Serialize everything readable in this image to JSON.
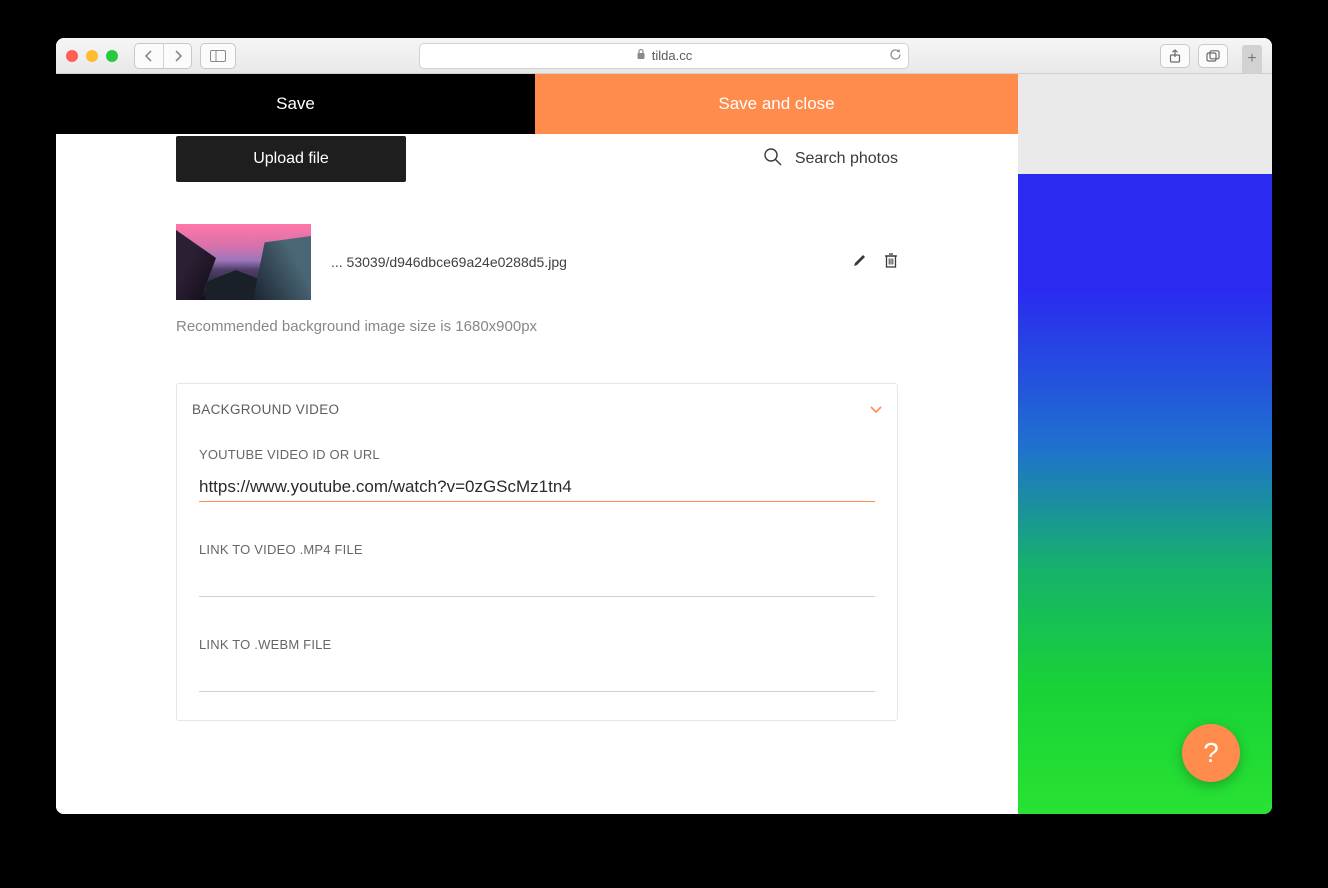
{
  "browser": {
    "url_host": "tilda.cc"
  },
  "actions": {
    "save": "Save",
    "save_and_close": "Save and close"
  },
  "upload": {
    "button": "Upload file",
    "search_photos": "Search photos"
  },
  "image": {
    "filename": "... 53039/d946dbce69a24e0288d5.jpg",
    "recommend": "Recommended background image size is 1680x900px"
  },
  "video": {
    "section_title": "BACKGROUND VIDEO",
    "youtube": {
      "label": "YOUTUBE VIDEO ID OR URL",
      "value": "https://www.youtube.com/watch?v=0zGScMz1tn4"
    },
    "mp4": {
      "label": "LINK TO VIDEO .MP4 FILE",
      "value": ""
    },
    "webm": {
      "label": "LINK TO .WEBM FILE",
      "value": ""
    }
  },
  "help": {
    "label": "?"
  }
}
